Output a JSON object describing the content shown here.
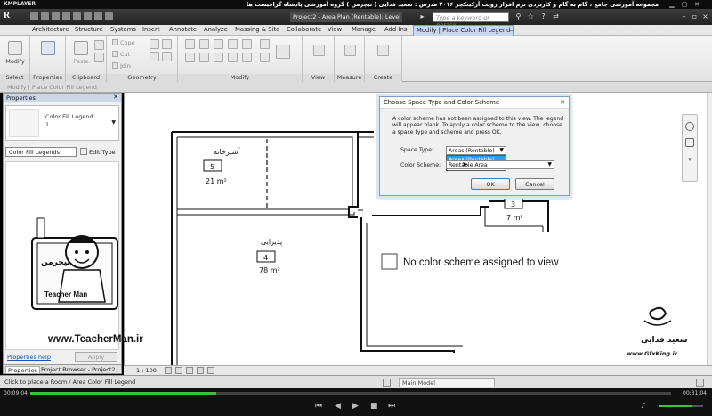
{
  "player": {
    "brand": "KMPLAYER",
    "title": "مجموعه آموزشی جامع ، گام به گام و کاربردی نرم افزار رویت آرکیتکچر ۲۰۱۶   مدرس : سعید فدایی ( تیچرمن ) گروه آموزشی پادشاه گرافیست ها",
    "time_current": "00:09:04",
    "time_total": "00:31:04",
    "progress_fraction": 0.29,
    "volume_fraction": 0.75
  },
  "app": {
    "logo": "R",
    "doc_tab": "Project2 - Area Plan (Rentable): Level 1",
    "search_placeholder": "Type a keyword or phrase"
  },
  "ribbon_tabs": [
    "Architecture",
    "Structure",
    "Systems",
    "Insert",
    "Annotate",
    "Analyze",
    "Massing & Site",
    "Collaborate",
    "View",
    "Manage",
    "Add-Ins"
  ],
  "contextual_tab": "Modify | Place Color Fill Legend",
  "ribbon": {
    "panels": {
      "select": "Select",
      "properties": "Properties",
      "clipboard": "Clipboard",
      "geometry": "Geometry",
      "modify": "Modify",
      "view": "View",
      "measure": "Measure",
      "create": "Create"
    },
    "modify_btn": "Modify",
    "paste_btn": "Paste",
    "cope": "Cope",
    "cut": "Cut",
    "join": "Join"
  },
  "options_bar": "Modify | Place Color Fill Legend",
  "properties": {
    "header": "Properties",
    "type_name": "Color Fill Legend",
    "type_sub": "1",
    "instance": "Color Fill Legends",
    "edit_type": "Edit Type",
    "help": "Properties help",
    "apply": "Apply",
    "tab_properties": "Properties",
    "tab_browser": "Project Browser - Project2"
  },
  "view_status": {
    "scale": "1 : 100"
  },
  "status": {
    "text": "Click to place a Room / Area Color Fill Legend",
    "model": "Main Model"
  },
  "rooms": [
    {
      "name": "آشپزخانه",
      "number": "5",
      "area": "21 m²"
    },
    {
      "name": "پذیرایی",
      "number": "4",
      "area": "78 m²"
    },
    {
      "name": "",
      "number": "3",
      "area": "7 m²"
    }
  ],
  "legend_msg": "No color scheme assigned to view",
  "dialog": {
    "title": "Choose Space Type and Color Scheme",
    "message": "A color scheme has not been assigned to this view. The legend will appear blank.  To apply a color scheme to the view, choose a space type and scheme and press OK.",
    "space_type_label": "Space Type:",
    "space_type_value": "Areas (Rentable)",
    "color_scheme_label": "Color Scheme:",
    "color_scheme_value": "Rentable Area",
    "dropdown_options": [
      "Areas (Rentable)",
      "Rooms"
    ],
    "ok": "OK",
    "cancel": "Cancel"
  },
  "overlays": {
    "teacherman_url": "www.TeacherMan.ir",
    "teacherman_name": "Teacher Man",
    "teacherman_logo": "تیچرمن",
    "gfx_url": "www.GfxKing.ir",
    "gfx_sign": "سعید فدایی"
  }
}
